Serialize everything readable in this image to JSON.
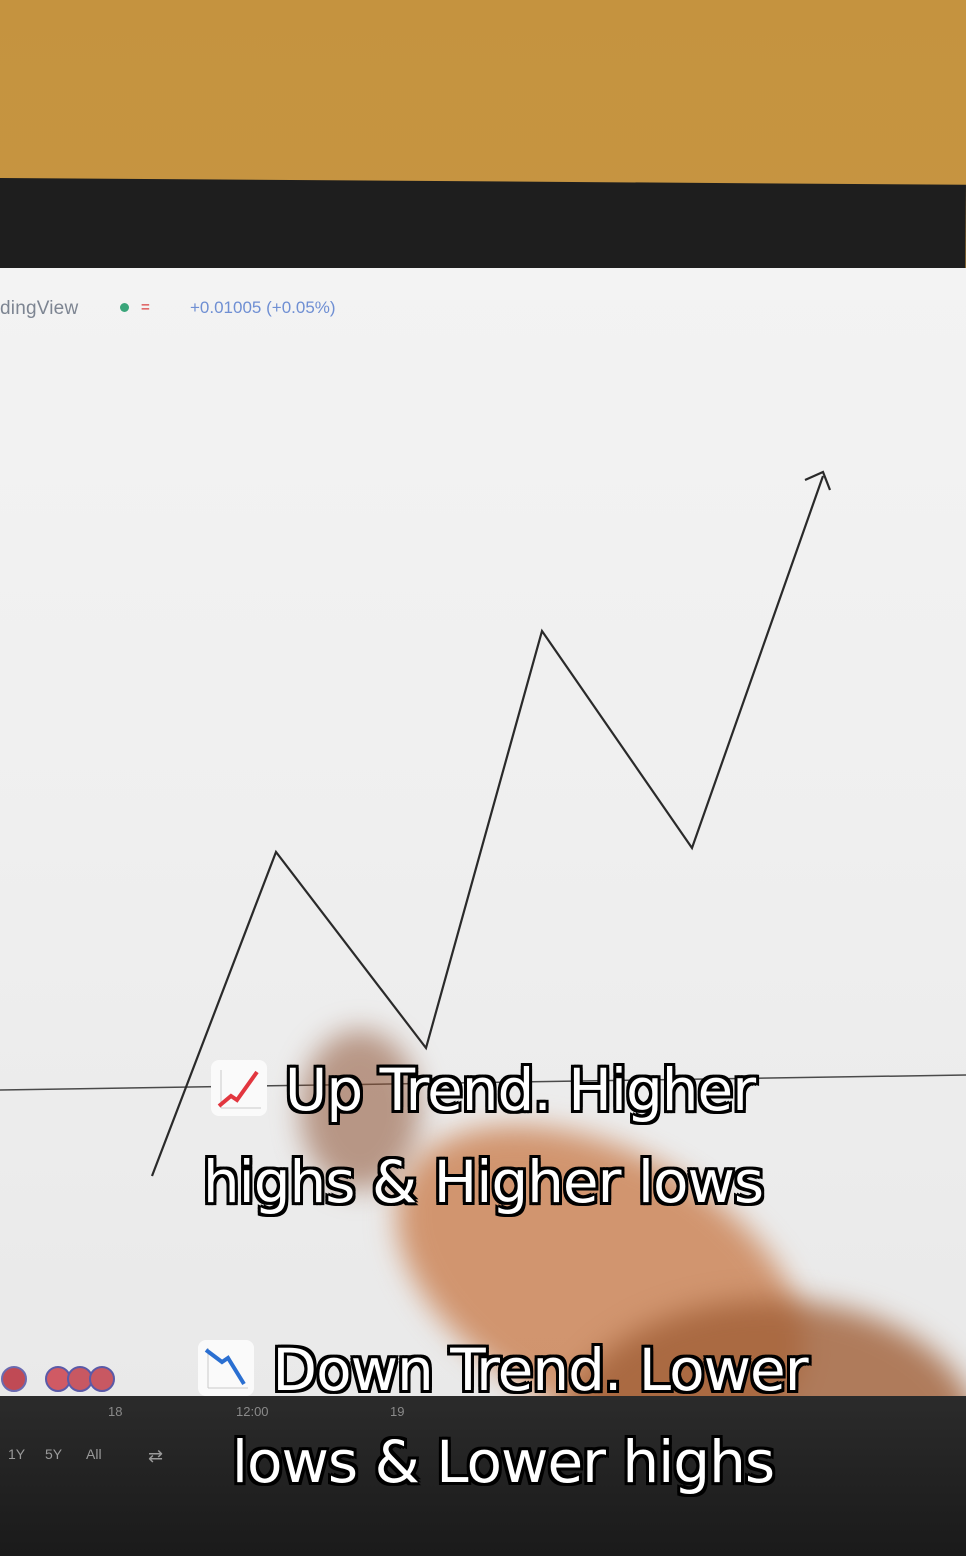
{
  "chart_header": {
    "brand": "dingView",
    "change": "+0.01005 (+0.05%)"
  },
  "axis": {
    "labels": [
      "18",
      "12:00",
      "19"
    ],
    "ranges": [
      "1Y",
      "5Y",
      "All"
    ]
  },
  "captions": {
    "uptrend": {
      "icon": "chart-increasing-icon",
      "line1": "Up Trend. Higher",
      "line2": "highs & Higher lows"
    },
    "downtrend": {
      "icon": "chart-decreasing-icon",
      "line1": "Down Trend. Lower",
      "line2": "lows & Lower highs"
    }
  },
  "colors": {
    "wall": "#c5933f",
    "screen": "#f0f0f0",
    "bezel": "#1e1e1e",
    "caption_text": "#ffffff",
    "caption_outline": "#000000"
  }
}
